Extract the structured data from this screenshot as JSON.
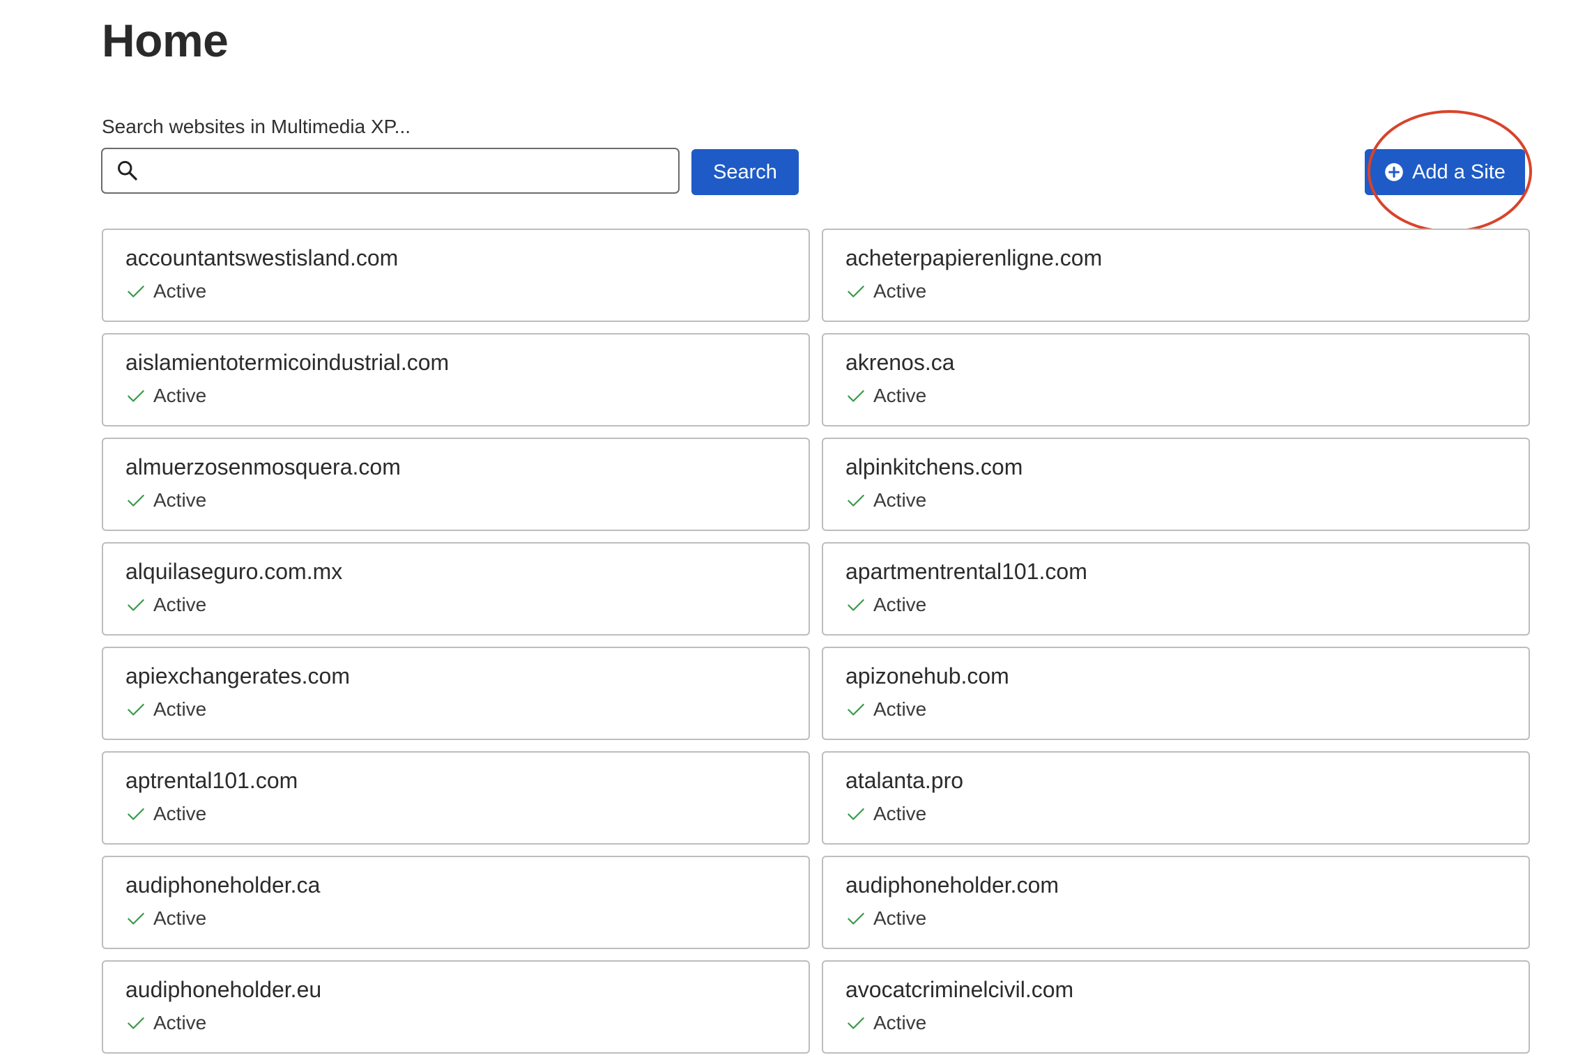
{
  "page": {
    "title": "Home"
  },
  "search": {
    "label": "Search websites in Multimedia XP...",
    "value": "",
    "placeholder": "",
    "button_label": "Search",
    "icon": "search-icon"
  },
  "add_site": {
    "label": "Add a Site",
    "icon": "plus-circle-icon",
    "highlight_color": "#d9432b"
  },
  "colors": {
    "primary": "#1e5bc6",
    "status_check": "#3a9a4a",
    "card_border": "#bdbdbd"
  },
  "sites": [
    {
      "name": "accountantswestisland.com",
      "status": "Active"
    },
    {
      "name": "acheterpapierenligne.com",
      "status": "Active"
    },
    {
      "name": "aislamientotermicoindustrial.com",
      "status": "Active"
    },
    {
      "name": "akrenos.ca",
      "status": "Active"
    },
    {
      "name": "almuerzosenmosquera.com",
      "status": "Active"
    },
    {
      "name": "alpinkitchens.com",
      "status": "Active"
    },
    {
      "name": "alquilaseguro.com.mx",
      "status": "Active"
    },
    {
      "name": "apartmentrental101.com",
      "status": "Active"
    },
    {
      "name": "apiexchangerates.com",
      "status": "Active"
    },
    {
      "name": "apizonehub.com",
      "status": "Active"
    },
    {
      "name": "aptrental101.com",
      "status": "Active"
    },
    {
      "name": "atalanta.pro",
      "status": "Active"
    },
    {
      "name": "audiphoneholder.ca",
      "status": "Active"
    },
    {
      "name": "audiphoneholder.com",
      "status": "Active"
    },
    {
      "name": "audiphoneholder.eu",
      "status": "Active"
    },
    {
      "name": "avocatcriminelcivil.com",
      "status": "Active"
    }
  ]
}
